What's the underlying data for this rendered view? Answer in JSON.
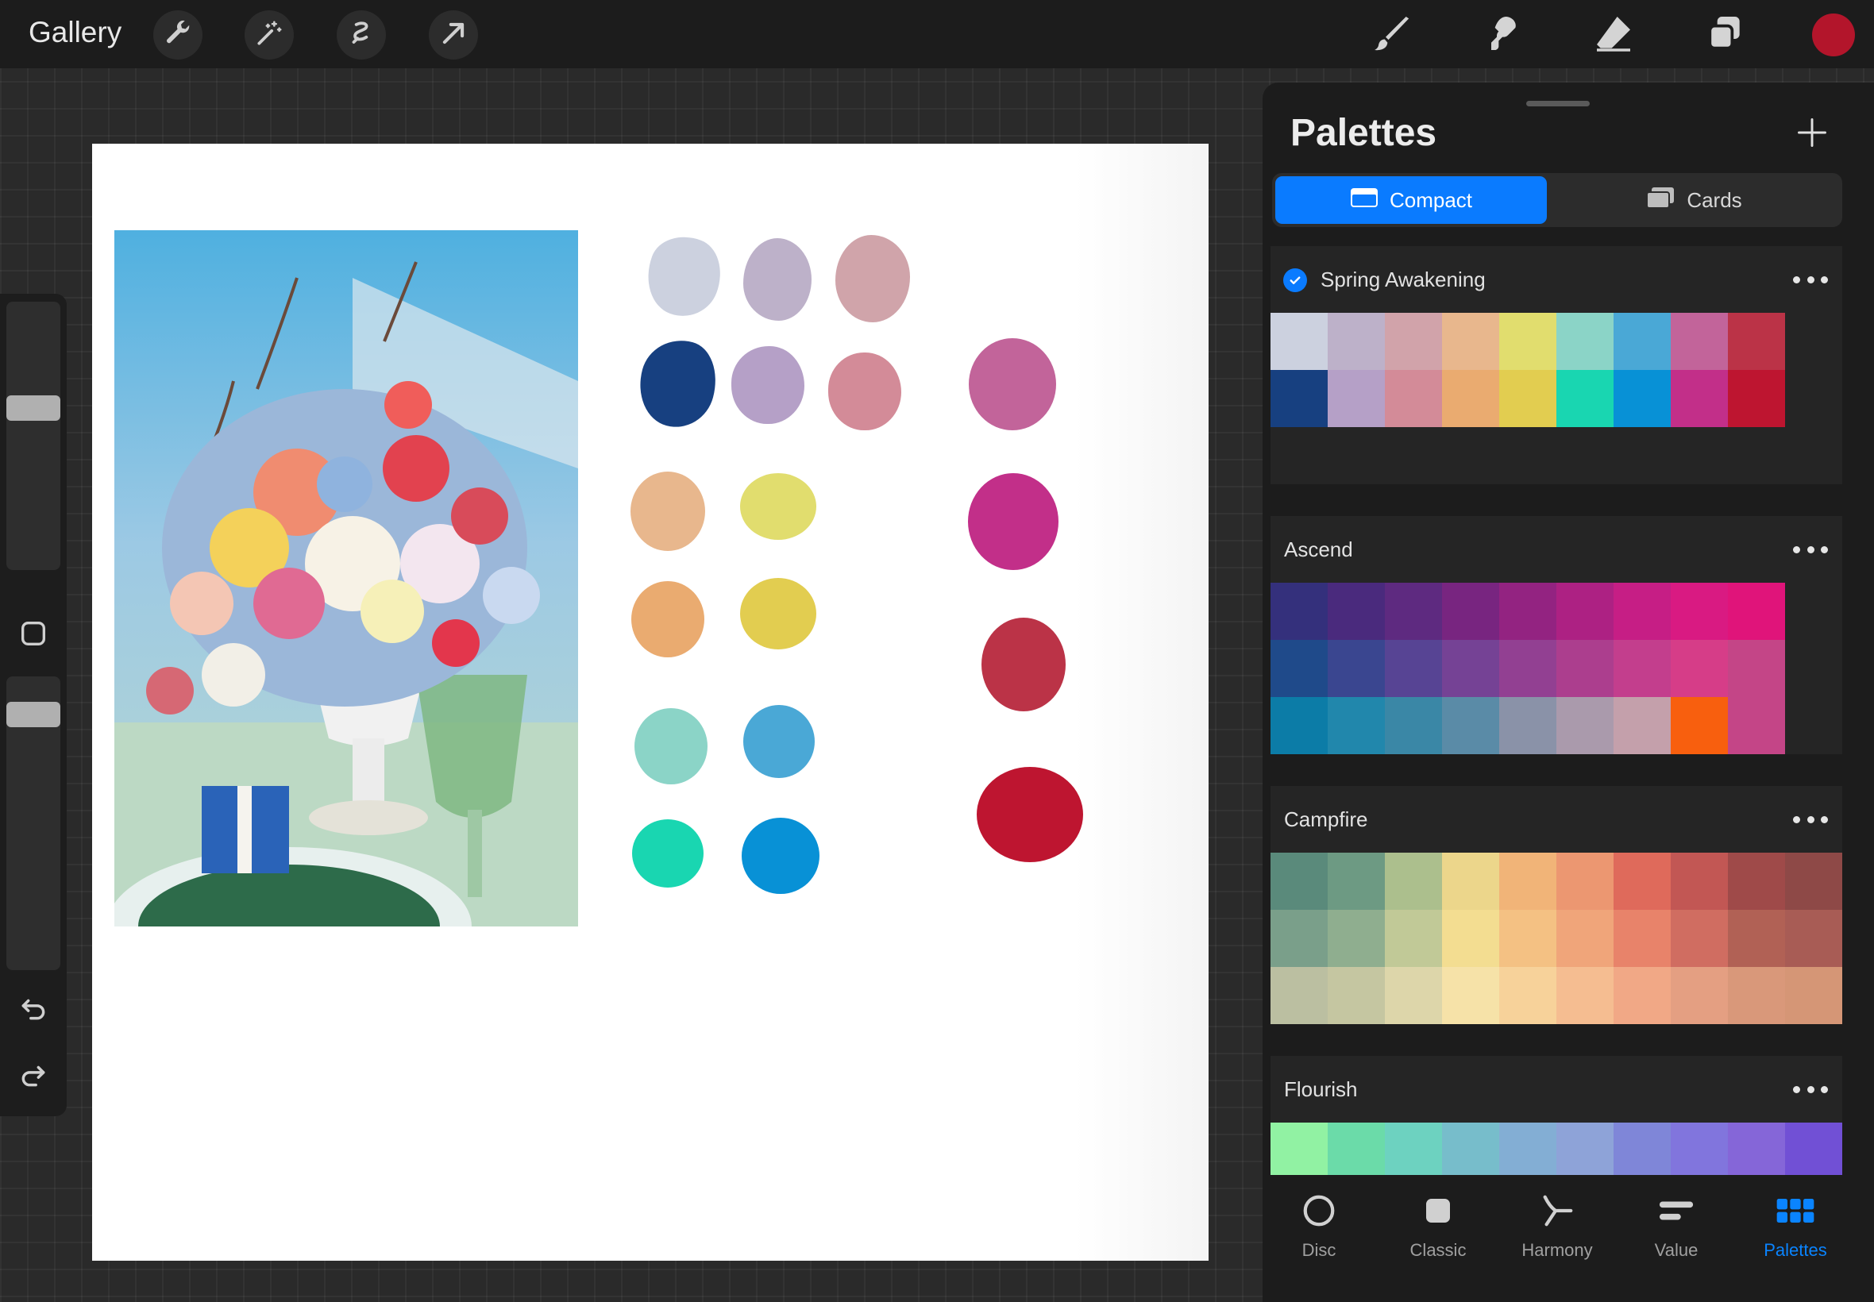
{
  "topbar": {
    "gallery_label": "Gallery",
    "left_tools": [
      "wrench-icon",
      "magic-wand-icon",
      "selection-icon",
      "transform-arrow-icon"
    ],
    "right_tools": [
      "brush-icon",
      "smudge-icon",
      "eraser-icon",
      "layers-icon"
    ],
    "current_color": "#b3152b"
  },
  "sidebar": {
    "controls": [
      "brush-size-slider",
      "modify-button",
      "opacity-slider",
      "undo-icon",
      "redo-icon"
    ]
  },
  "canvas": {
    "photo_description_icon": "flower-bouquet-photo",
    "swatch_colors": [
      "#ccd1df",
      "#bdb1c9",
      "#d0a4aa",
      "#174080",
      "#b5a0c7",
      "#d38b98",
      "#c2649a",
      "#e8b78d",
      "#e1dd6e",
      "#c22f89",
      "#eaab70",
      "#e2cd50",
      "#bb3347",
      "#8bd4c7",
      "#4aa8d6",
      "#19d6b1",
      "#0891d6",
      "#be1530"
    ]
  },
  "panel": {
    "title": "Palettes",
    "segments": {
      "compact": "Compact",
      "cards": "Cards"
    },
    "palettes": [
      {
        "name": "Spring Awakening",
        "default": true,
        "rows": [
          [
            "#ccd1df",
            "#bdb1c9",
            "#d1a3aa",
            "#e8b78d",
            "#e1dd6e",
            "#8bd4c7",
            "#4aa8d6",
            "#c2649a",
            "#bb3347"
          ],
          [
            "#174080",
            "#b5a0c7",
            "#d38b98",
            "#eaab70",
            "#e2cd50",
            "#19d6b1",
            "#0891d6",
            "#c22f89",
            "#be1530"
          ]
        ]
      },
      {
        "name": "Ascend",
        "default": false,
        "rows": [
          [
            "#34307c",
            "#4a2a7d",
            "#5e2a80",
            "#782580",
            "#932381",
            "#ad2183",
            "#c61e85",
            "#d91a82",
            "#e0147a"
          ],
          [
            "#1f4a8a",
            "#3a4690",
            "#574494",
            "#754295",
            "#924092",
            "#ac3e8e",
            "#c33e8d",
            "#d63d88",
            "#c44587"
          ],
          [
            "#0c7ca7",
            "#2187ac",
            "#3a87a6",
            "#5a8ba7",
            "#8a92a8",
            "#aa9aac",
            "#c4a0ab",
            "#f85f0e",
            "#c44587"
          ]
        ]
      },
      {
        "name": "Campfire",
        "default": false,
        "rows": [
          [
            "#5a8a7b",
            "#6d9a83",
            "#acbf8d",
            "#ecd68b",
            "#f1b478",
            "#ec9771",
            "#df6a5b",
            "#c25754",
            "#9f4a49",
            "#8e4947"
          ],
          [
            "#7a9f8a",
            "#8fae8f",
            "#c1c997",
            "#f3dd91",
            "#f4c183",
            "#f0a57a",
            "#e8836a",
            "#d06d61",
            "#b16155",
            "#a85c55"
          ],
          [
            "#bbbfa1",
            "#c5c6a1",
            "#ddd6aa",
            "#f6e2a8",
            "#f7d29a",
            "#f5bd91",
            "#f1a886",
            "#e49f82",
            "#d9987a",
            "#d59676"
          ]
        ]
      },
      {
        "name": "Flourish",
        "default": false,
        "rows": [
          [
            "#91f2a3",
            "#6bdba9",
            "#6dd2c0",
            "#77bdcb",
            "#83aed4",
            "#8ea3d8",
            "#7f86d8",
            "#8175dd",
            "#8566d8",
            "#7150d5"
          ]
        ]
      }
    ]
  },
  "tabs": [
    {
      "label": "Disc",
      "icon": "disc-icon",
      "active": false
    },
    {
      "label": "Classic",
      "icon": "classic-square-icon",
      "active": false
    },
    {
      "label": "Harmony",
      "icon": "harmony-icon",
      "active": false
    },
    {
      "label": "Value",
      "icon": "value-sliders-icon",
      "active": false
    },
    {
      "label": "Palettes",
      "icon": "palettes-grid-icon",
      "active": true
    }
  ]
}
